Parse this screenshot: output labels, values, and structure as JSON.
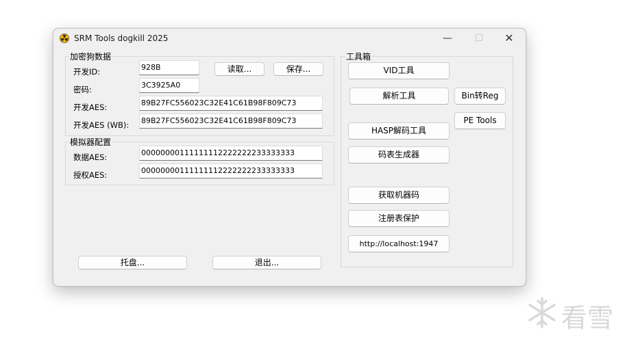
{
  "window": {
    "title": "SRM Tools dogkill 2025",
    "controls": {
      "minimize": "—",
      "maximize": "☐",
      "close": "✕"
    }
  },
  "dongle_group": {
    "title": "加密狗数据",
    "dev_id_label": "开发ID:",
    "dev_id_value": "928B",
    "password_label": "密码:",
    "password_value": "3C3925A0",
    "dev_aes_label": "开发AES:",
    "dev_aes_value": "89B27FC556023C32E41C61B98F809C73",
    "dev_aes_wb_label": "开发AES (WB):",
    "dev_aes_wb_value": "89B27FC556023C32E41C61B98F809C73",
    "read_button": "读取...",
    "save_button": "保存..."
  },
  "emulator_group": {
    "title": "模拟器配置",
    "data_aes_label": "数据AES:",
    "data_aes_value": "00000000111111112222222233333333",
    "auth_aes_label": "授权AES:",
    "auth_aes_value": "00000000111111112222222233333333"
  },
  "bottom_buttons": {
    "tray": "托盘...",
    "exit": "退出..."
  },
  "toolbox": {
    "title": "工具箱",
    "vid_tool": "VID工具",
    "parse_tool": "解析工具",
    "bin_to_reg": "Bin转Reg",
    "pe_tools": "PE Tools",
    "hasp_decode": "HASP解码工具",
    "code_table": "码表生成器",
    "machine_code": "获取机器码",
    "registry_protect": "注册表保护",
    "localhost": "http://localhost:1947"
  },
  "watermark": {
    "text": "看雪"
  },
  "colors": {
    "window_bg": "#f0f0f0",
    "icon_yellow": "#f2b705",
    "icon_dark": "#2b2b2b",
    "watermark": "#d9d9d9"
  },
  "icons": {
    "app": "radiation-icon",
    "watermark": "snowflake-icon"
  }
}
